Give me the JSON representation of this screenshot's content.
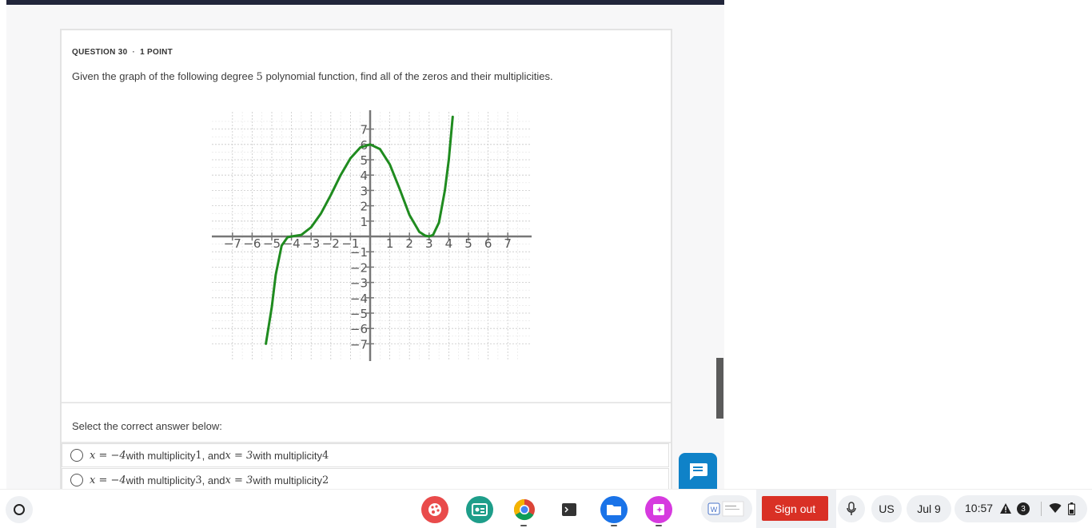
{
  "question": {
    "number_label": "QUESTION 30",
    "points_label": "1 POINT",
    "text_before": "Given the graph of the following degree ",
    "degree": "5",
    "text_after": " polynomial function, find all of the zeros and their multiplicities."
  },
  "chart_data": {
    "type": "line",
    "xlim": [
      -7,
      7
    ],
    "ylim": [
      -7,
      7
    ],
    "x_tick_labels": [
      "−7",
      "−6",
      "−5",
      "−4",
      "−3",
      "−2",
      "−1",
      "1",
      "2",
      "3",
      "4",
      "5",
      "6",
      "7"
    ],
    "y_tick_labels": [
      "7",
      "6",
      "5",
      "4",
      "3",
      "2",
      "1",
      "−1",
      "−2",
      "−3",
      "−4",
      "−5",
      "−6",
      "−7"
    ],
    "grid": true,
    "series": [
      {
        "color": "#1f8b1f",
        "x": [
          -5.3,
          -5.0,
          -4.8,
          -4.5,
          -4.2,
          -4.0,
          -3.5,
          -3.0,
          -2.5,
          -2.0,
          -1.5,
          -1.0,
          -0.5,
          0.0,
          0.5,
          1.0,
          1.5,
          2.0,
          2.5,
          2.8,
          3.0,
          3.2,
          3.5,
          3.8,
          4.0,
          4.2
        ],
        "y": [
          -7.0,
          -4.6,
          -2.5,
          -0.6,
          -0.05,
          0.0,
          0.1,
          0.6,
          1.5,
          2.7,
          4.0,
          5.1,
          5.8,
          6.0,
          5.7,
          4.7,
          3.1,
          1.4,
          0.3,
          0.05,
          0.0,
          0.1,
          0.9,
          3.0,
          5.0,
          7.8
        ]
      }
    ]
  },
  "select_prompt": "Select the correct answer below:",
  "options": [
    {
      "zero1": "x = −4",
      "mult_label": " with multiplicity ",
      "mult1": "1",
      "and_label": ", and ",
      "zero2": "x = 3",
      "mult2": "4"
    },
    {
      "zero1": "x = −4",
      "mult_label": " with multiplicity ",
      "mult1": "3",
      "and_label": ", and ",
      "zero2": "x = 3",
      "mult2": "2"
    }
  ],
  "shelf": {
    "apps": [
      {
        "name": "palette-app-icon",
        "color": "#e94b4b"
      },
      {
        "name": "classroom-app-icon",
        "color": "#1e9e8a"
      },
      {
        "name": "chrome-icon",
        "color": "#4285f4"
      },
      {
        "name": "terminal-app-icon",
        "color": "#333333"
      },
      {
        "name": "files-app-icon",
        "color": "#1a73e8"
      },
      {
        "name": "screencast-app-icon",
        "color": "#d63adf"
      }
    ],
    "sign_out": "Sign out",
    "keyboard": "US",
    "date": "Jul 9",
    "time": "10:57",
    "notification_count": "3"
  }
}
